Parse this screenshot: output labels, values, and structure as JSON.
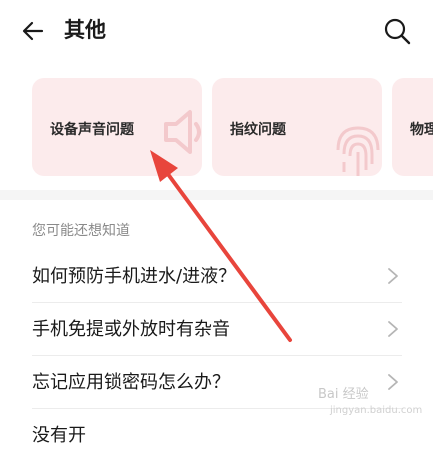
{
  "header": {
    "title": "其他",
    "back_icon": "arrow-left-icon",
    "search_icon": "search-icon"
  },
  "cards": [
    {
      "label": "设备声音问题",
      "icon": "speaker-icon"
    },
    {
      "label": "指纹问题",
      "icon": "fingerprint-icon"
    },
    {
      "label": "物理"
    }
  ],
  "faq": {
    "section_title": "您可能还想知道",
    "items": [
      {
        "label": "如何预防手机进水/进液？"
      },
      {
        "label": "手机免提或外放时有杂音"
      },
      {
        "label": "忘记应用锁密码怎么办？"
      },
      {
        "label": "没有开"
      }
    ]
  },
  "annotation": {
    "color": "#e8453c"
  },
  "watermark": {
    "text": "Bai 经验",
    "sub": "jingyan.baidu.com"
  },
  "colors": {
    "card_bg": "#fcebec",
    "section_bg": "#f5f5f5"
  }
}
